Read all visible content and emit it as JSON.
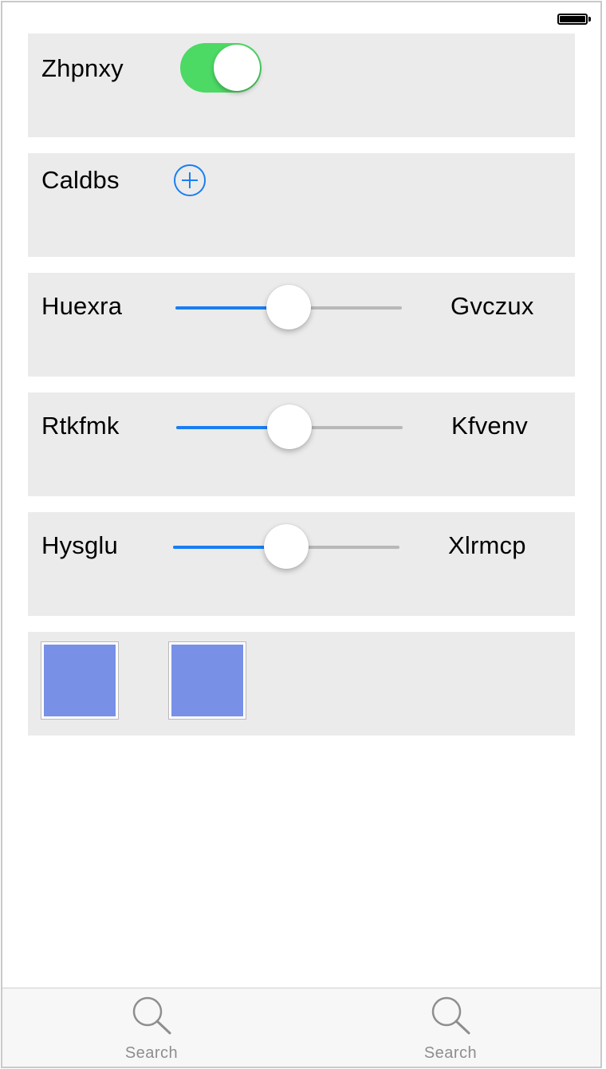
{
  "status_bar": {
    "battery_icon": "battery-full-icon"
  },
  "rows": {
    "toggle_row": {
      "label": "Zhpnxy",
      "toggle_on": true,
      "toggle_color": "#4cd964"
    },
    "add_row": {
      "label": "Caldbs",
      "button_icon": "plus-circle-icon",
      "button_color": "#1a7ef2"
    },
    "slider_rows": [
      {
        "left_label": "Huexra",
        "right_label": "Gvczux",
        "value": 0.5
      },
      {
        "left_label": "Rtkfmk",
        "right_label": "Kfvenv",
        "value": 0.5
      },
      {
        "left_label": "Hysglu",
        "right_label": "Xlrmcp",
        "value": 0.5
      }
    ],
    "image_row": {
      "images": [
        {
          "color": "#7890e6"
        },
        {
          "color": "#7890e6"
        }
      ]
    }
  },
  "tab_bar": {
    "tabs": [
      {
        "label": "Search",
        "icon": "search-icon"
      },
      {
        "label": "Search",
        "icon": "search-icon"
      }
    ]
  }
}
